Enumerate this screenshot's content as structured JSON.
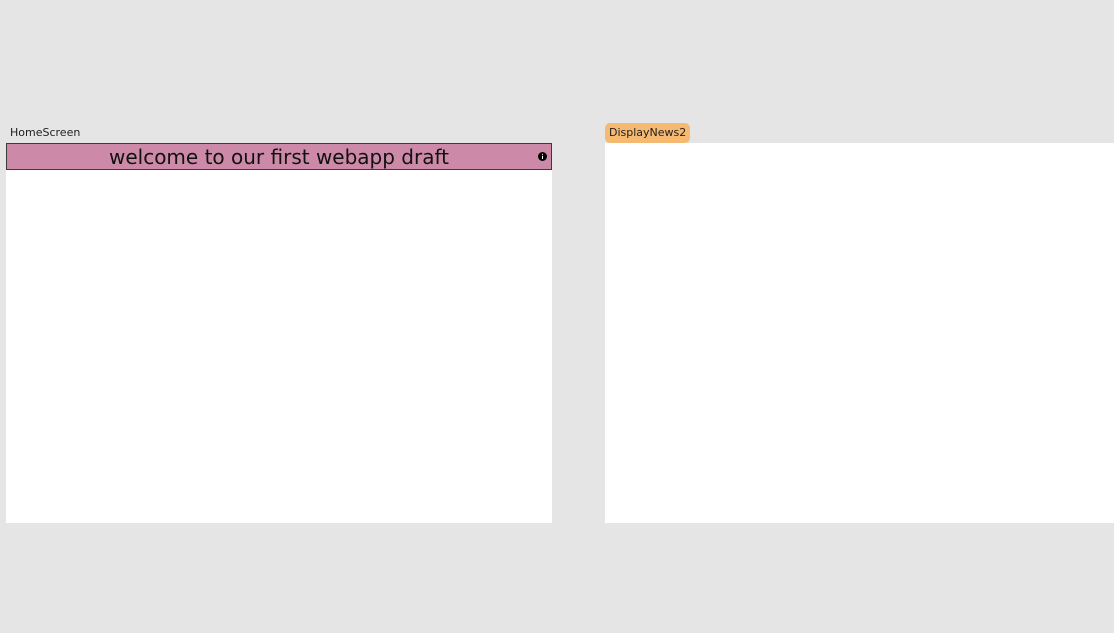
{
  "canvas": {
    "background": "#e5e5e5"
  },
  "frames": {
    "home": {
      "label": "HomeScreen",
      "banner": {
        "text": "welcome to our first webapp draft",
        "color": "#cc8aa8",
        "icon": "info-icon"
      }
    },
    "news": {
      "label": "DisplayNews2",
      "label_color": "#f5b971",
      "selected": true
    }
  }
}
